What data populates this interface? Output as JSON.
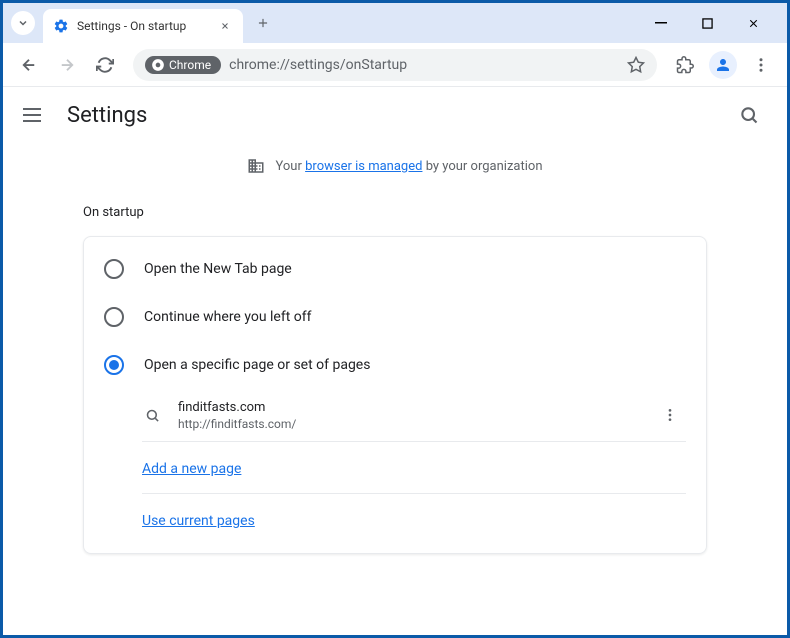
{
  "window": {
    "tab_title": "Settings - On startup"
  },
  "toolbar": {
    "chrome_chip": "Chrome",
    "url": "chrome://settings/onStartup"
  },
  "header": {
    "title": "Settings"
  },
  "managed": {
    "prefix": "Your",
    "link": "browser is managed",
    "suffix": "by your organization"
  },
  "section": {
    "title": "On startup"
  },
  "options": {
    "opt1": "Open the New Tab page",
    "opt2": "Continue where you left off",
    "opt3": "Open a specific page or set of pages"
  },
  "page": {
    "name": "finditfasts.com",
    "url": "http://finditfasts.com/"
  },
  "links": {
    "add": "Add a new page",
    "current": "Use current pages"
  }
}
